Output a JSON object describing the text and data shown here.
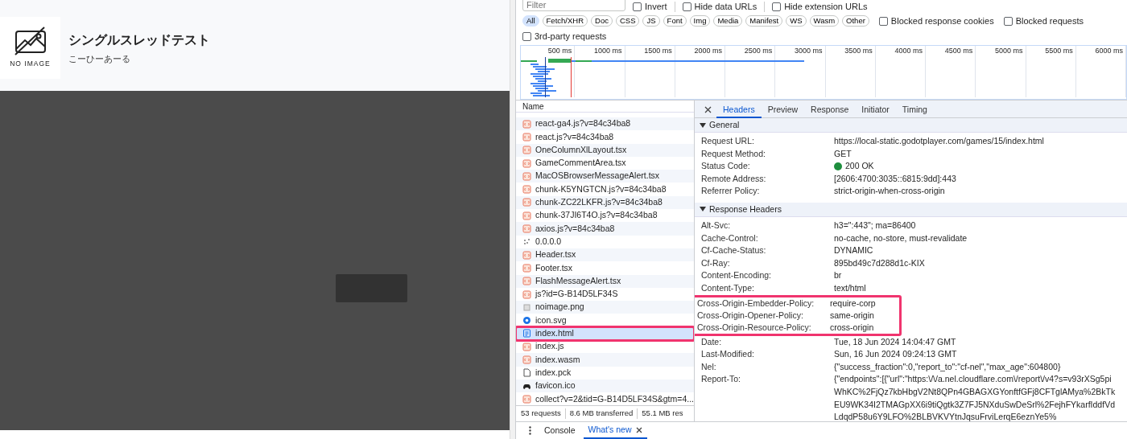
{
  "page": {
    "thumbnail": {
      "caption": "NO IMAGE"
    },
    "title": "シングルスレッドテスト",
    "author": "こーひーあーる"
  },
  "devtools": {
    "filter": {
      "placeholder": "Filter"
    },
    "options_row1": [
      {
        "label": "Invert",
        "checked": false
      },
      {
        "label": "Hide data URLs",
        "checked": false
      },
      {
        "label": "Hide extension URLs",
        "checked": false
      }
    ],
    "type_chips": [
      {
        "label": "All",
        "selected": true
      },
      {
        "label": "Fetch/XHR",
        "selected": false
      },
      {
        "label": "Doc",
        "selected": false
      },
      {
        "label": "CSS",
        "selected": false
      },
      {
        "label": "JS",
        "selected": false
      },
      {
        "label": "Font",
        "selected": false
      },
      {
        "label": "Img",
        "selected": false
      },
      {
        "label": "Media",
        "selected": false
      },
      {
        "label": "Manifest",
        "selected": false
      },
      {
        "label": "WS",
        "selected": false
      },
      {
        "label": "Wasm",
        "selected": false
      },
      {
        "label": "Other",
        "selected": false
      }
    ],
    "options_row2": [
      {
        "label": "Blocked response cookies",
        "checked": false
      },
      {
        "label": "Blocked requests",
        "checked": false
      }
    ],
    "options_row3": [
      {
        "label": "3rd-party requests",
        "checked": false
      }
    ],
    "timeline_ticks": [
      "500 ms",
      "1000 ms",
      "1500 ms",
      "2000 ms",
      "2500 ms",
      "3000 ms",
      "3500 ms",
      "4000 ms",
      "4500 ms",
      "5000 ms",
      "5500 ms",
      "6000 ms"
    ],
    "requests": {
      "column": "Name",
      "rows": [
        {
          "name": "react-ga4.js?v=84c34ba8",
          "kind": "script",
          "selected": false,
          "highlighted": false
        },
        {
          "name": "react.js?v=84c34ba8",
          "kind": "script",
          "selected": false,
          "highlighted": false
        },
        {
          "name": "OneColumnXlLayout.tsx",
          "kind": "script",
          "selected": false,
          "highlighted": false
        },
        {
          "name": "GameCommentArea.tsx",
          "kind": "script",
          "selected": false,
          "highlighted": false
        },
        {
          "name": "MacOSBrowserMessageAlert.tsx",
          "kind": "script",
          "selected": false,
          "highlighted": false
        },
        {
          "name": "chunk-K5YNGTCN.js?v=84c34ba8",
          "kind": "script",
          "selected": false,
          "highlighted": false
        },
        {
          "name": "chunk-ZC22LKFR.js?v=84c34ba8",
          "kind": "script",
          "selected": false,
          "highlighted": false
        },
        {
          "name": "chunk-37JI6T4O.js?v=84c34ba8",
          "kind": "script",
          "selected": false,
          "highlighted": false
        },
        {
          "name": "axios.js?v=84c34ba8",
          "kind": "script",
          "selected": false,
          "highlighted": false
        },
        {
          "name": "0.0.0.0",
          "kind": "other",
          "selected": false,
          "highlighted": false
        },
        {
          "name": "Header.tsx",
          "kind": "script",
          "selected": false,
          "highlighted": false
        },
        {
          "name": "Footer.tsx",
          "kind": "script",
          "selected": false,
          "highlighted": false
        },
        {
          "name": "FlashMessageAlert.tsx",
          "kind": "script",
          "selected": false,
          "highlighted": false
        },
        {
          "name": "js?id=G-B14D5LF34S",
          "kind": "script",
          "selected": false,
          "highlighted": false
        },
        {
          "name": "noimage.png",
          "kind": "image",
          "selected": false,
          "highlighted": false
        },
        {
          "name": "icon.svg",
          "kind": "svg",
          "selected": false,
          "highlighted": false
        },
        {
          "name": "index.html",
          "kind": "document",
          "selected": true,
          "highlighted": true
        },
        {
          "name": "index.js",
          "kind": "script",
          "selected": false,
          "highlighted": false
        },
        {
          "name": "index.wasm",
          "kind": "script",
          "selected": false,
          "highlighted": false
        },
        {
          "name": "index.pck",
          "kind": "file",
          "selected": false,
          "highlighted": false
        },
        {
          "name": "favicon.ico",
          "kind": "favicon",
          "selected": false,
          "highlighted": false
        },
        {
          "name": "collect?v=2&tid=G-B14D5LF34S&gtm=4...",
          "kind": "script",
          "selected": false,
          "highlighted": false
        }
      ]
    },
    "summary": [
      "53 requests",
      "8.6 MB transferred",
      "55.1 MB res"
    ],
    "detail_tabs": [
      {
        "label": "Headers",
        "selected": true
      },
      {
        "label": "Preview",
        "selected": false
      },
      {
        "label": "Response",
        "selected": false
      },
      {
        "label": "Initiator",
        "selected": false
      },
      {
        "label": "Timing",
        "selected": false
      }
    ],
    "sections": [
      {
        "title": "General",
        "expanded": true,
        "rows": [
          {
            "label": "Request URL:",
            "value": "https://local-static.godotplayer.com/games/15/index.html",
            "highlighted": false
          },
          {
            "label": "Request Method:",
            "value": "GET",
            "highlighted": false
          },
          {
            "label": "Status Code:",
            "value": "200 OK",
            "color": "#1e8e3e",
            "highlighted": false
          },
          {
            "label": "Remote Address:",
            "value": "[2606:4700:3035::6815:9dd]:443",
            "highlighted": false
          },
          {
            "label": "Referrer Policy:",
            "value": "strict-origin-when-cross-origin",
            "highlighted": false
          }
        ]
      },
      {
        "title": "Response Headers",
        "expanded": true,
        "rows": [
          {
            "label": "Alt-Svc:",
            "value": "h3=\":443\"; ma=86400",
            "highlighted": false
          },
          {
            "label": "Cache-Control:",
            "value": "no-cache, no-store, must-revalidate",
            "highlighted": false
          },
          {
            "label": "Cf-Cache-Status:",
            "value": "DYNAMIC",
            "highlighted": false
          },
          {
            "label": "Cf-Ray:",
            "value": "895bd49c7d288d1c-KIX",
            "highlighted": false
          },
          {
            "label": "Content-Encoding:",
            "value": "br",
            "highlighted": false
          },
          {
            "label": "Content-Type:",
            "value": "text/html",
            "highlighted": false
          },
          {
            "label": "Cross-Origin-Embedder-Policy:",
            "value": "require-corp",
            "highlighted": true
          },
          {
            "label": "Cross-Origin-Opener-Policy:",
            "value": "same-origin",
            "highlighted": true
          },
          {
            "label": "Cross-Origin-Resource-Policy:",
            "value": "cross-origin",
            "highlighted": true
          },
          {
            "label": "Date:",
            "value": "Tue, 18 Jun 2024 14:04:47 GMT",
            "highlighted": false
          },
          {
            "label": "Last-Modified:",
            "value": "Sun, 16 Jun 2024 09:24:13 GMT",
            "highlighted": false
          },
          {
            "label": "Nel:",
            "value": "{\"success_fraction\":0,\"report_to\":\"cf-nel\",\"max_age\":604800}",
            "highlighted": false
          },
          {
            "label": "Report-To:",
            "value": "{\"endpoints\":[{\"url\":\"https:\\/\\/a.nel.cloudflare.com\\/report\\/v4?s=v93rXSg5piWhKC%2FjQz7kbHbgV2Nt8QPn4GBAGXGYonftfGFj8CFTglAMya%2BkTkEU9WK34I2TMAGpXX6i9tiQgtk3Z7FJ5NXduSwDeSrl%2FejhFYkarfIddfVdLdqdP58u6Y9LFO%2BLBVKVYtnJqsuFrviLerqE6eznYe5%",
            "highlighted": false
          }
        ]
      }
    ],
    "drawer_tabs": [
      {
        "label": "Console",
        "selected": false
      },
      {
        "label": "What's new",
        "selected": true
      }
    ]
  }
}
